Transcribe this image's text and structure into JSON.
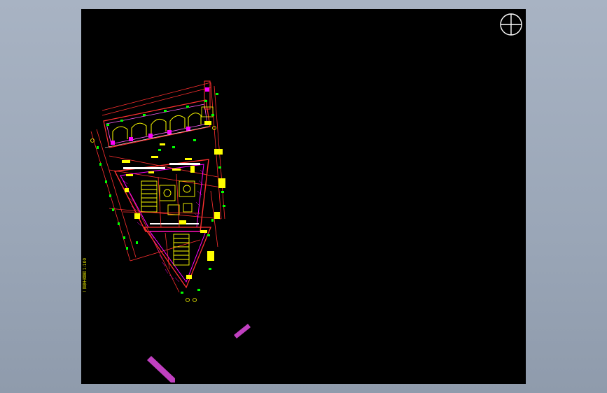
{
  "viewport": {
    "background": "#000000",
    "frame_color": "#a3aebd"
  },
  "compass": {
    "icon": "crosshair-circle-icon",
    "color": "#ffffff"
  },
  "plan": {
    "layer_colors": {
      "walls": "#ff2a2a",
      "hatch": "#ff00ff",
      "furniture": "#ffff00",
      "dimensions": "#00ff00",
      "outline_white": "#ffffff"
    },
    "vertical_label": "二层平面图 1:100"
  }
}
